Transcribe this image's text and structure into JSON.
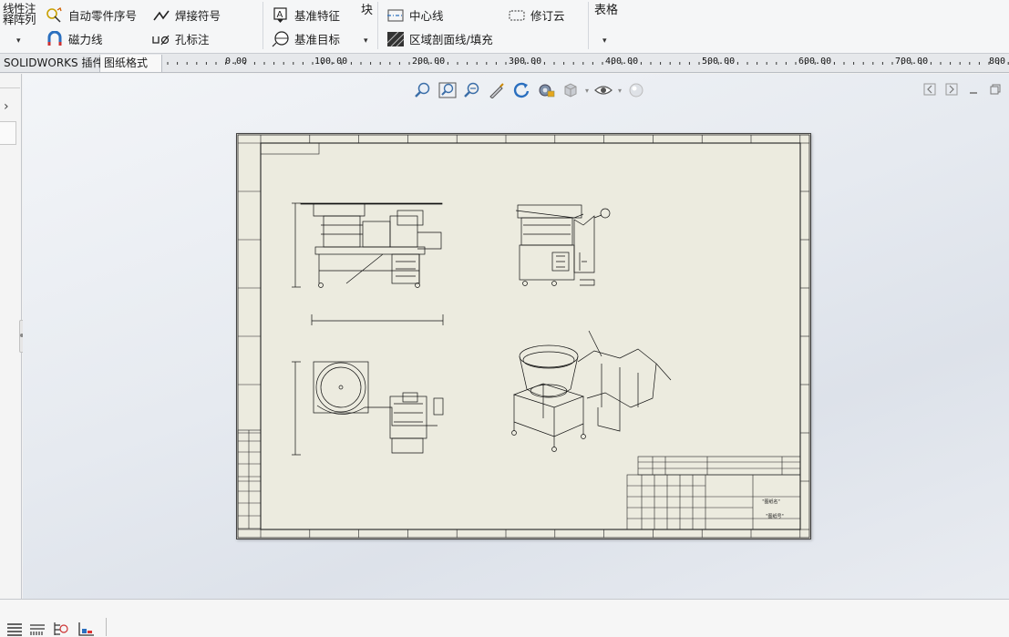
{
  "ribbon": {
    "stack_label_line1": "线性注",
    "stack_label_line2": "释阵列",
    "auto_balloon": "自动零件序号",
    "magnetic_line": "磁力线",
    "weld_symbol": "焊接符号",
    "hole_callout": "孔标注",
    "datum_feature": "基准特征",
    "datum_target": "基准目标",
    "block_label": "块",
    "center_line": "中心线",
    "area_hatch": "区域剖面线/填充",
    "revision_cloud": "修订云",
    "table_label": "表格"
  },
  "tabs": [
    {
      "label": "SOLIDWORKS 插件"
    },
    {
      "label": "图纸格式"
    }
  ],
  "ruler": {
    "labels": [
      "0.00",
      "100.00",
      "200.00",
      "300.00",
      "400.00",
      "500.00",
      "600.00",
      "700.00",
      "800"
    ]
  },
  "drawing": {
    "title_block_text_1": "\"图纸名\"",
    "title_block_text_2": "\"图纸号\""
  },
  "colors": {
    "ribbon_bg": "#f5f6f7",
    "sheet_bg": "#ecebdf",
    "accent_blue": "#2a6fbf"
  }
}
